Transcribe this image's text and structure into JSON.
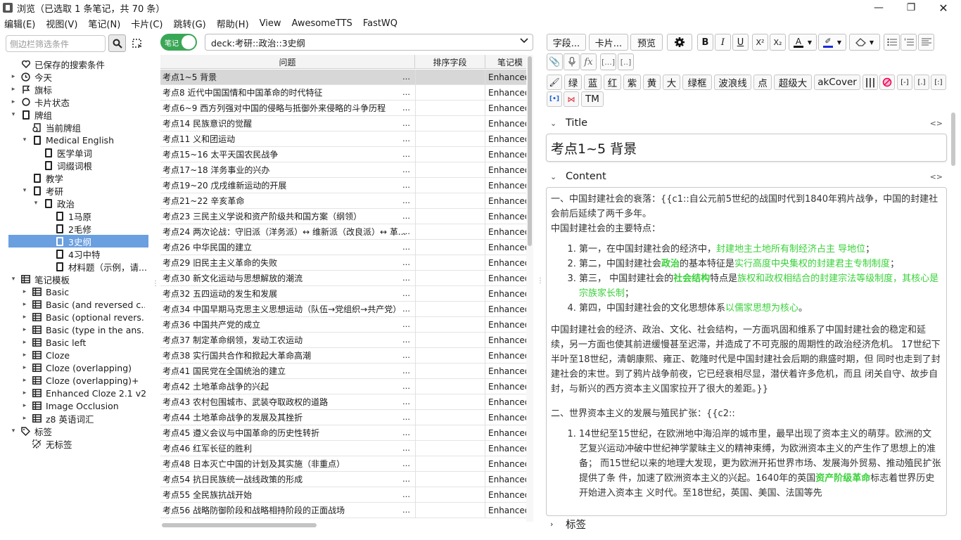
{
  "window": {
    "title": "浏览（已选取 1 条笔记，共 70 条）"
  },
  "menu": [
    "编辑(E)",
    "视图(V)",
    "笔记(N)",
    "卡片(C)",
    "跳转(G)",
    "帮助(H)",
    "View",
    "AwesomeTTS",
    "FastWQ"
  ],
  "sidebar": {
    "search_placeholder": "侧边栏筛选条件",
    "items": [
      {
        "label": "已保存的搜索条件"
      },
      {
        "label": "今天"
      },
      {
        "label": "旗标"
      },
      {
        "label": "卡片状态"
      },
      {
        "label": "牌组"
      },
      {
        "label": "当前牌组"
      },
      {
        "label": "Medical English"
      },
      {
        "label": "医学单词"
      },
      {
        "label": "词缀词根"
      },
      {
        "label": "教学"
      },
      {
        "label": "考研"
      },
      {
        "label": "政治"
      },
      {
        "label": "1马原"
      },
      {
        "label": "2毛修"
      },
      {
        "label": "3史纲"
      },
      {
        "label": "4习中特"
      },
      {
        "label": "材料题（示例，请..."
      },
      {
        "label": "笔记模板"
      },
      {
        "label": "Basic"
      },
      {
        "label": "Basic (and reversed c..."
      },
      {
        "label": "Basic (optional revers..."
      },
      {
        "label": "Basic (type in the ans..."
      },
      {
        "label": "Basic left"
      },
      {
        "label": "Cloze"
      },
      {
        "label": "Cloze (overlapping)"
      },
      {
        "label": "Cloze (overlapping)+"
      },
      {
        "label": "Enhanced Cloze 2.1 v2"
      },
      {
        "label": "Image Occlusion"
      },
      {
        "label": "z8 英语词汇"
      },
      {
        "label": "标签"
      },
      {
        "label": "无标签"
      }
    ]
  },
  "browser": {
    "toggle_label": "笔记",
    "search_value": "deck:考研::政治::3史纲",
    "columns": [
      "问题",
      "排序字段",
      "笔记模"
    ],
    "rows": [
      {
        "q": "考点1~5 背景",
        "type": "Enhanced"
      },
      {
        "q": "考点8 近代中国国情和中国革命的时代特征",
        "type": "Enhanced"
      },
      {
        "q": "考点6~9 西方列强对中国的侵略与抵御外来侵略的斗争历程",
        "type": "Enhanced"
      },
      {
        "q": "考点14 民族意识的觉醒",
        "type": "Enhanced"
      },
      {
        "q": "考点11 义和团运动",
        "type": "Enhanced"
      },
      {
        "q": "考点15~16 太平天国农民战争",
        "type": "Enhanced"
      },
      {
        "q": "考点17~18 洋务事业的兴办",
        "type": "Enhanced"
      },
      {
        "q": "考点19~20 戊戌维新运动的开展",
        "type": "Enhanced"
      },
      {
        "q": "考点21~22 辛亥革命",
        "type": "Enhanced"
      },
      {
        "q": "考点23 三民主义学说和资产阶级共和国方案（纲领）",
        "type": "Enhanced"
      },
      {
        "q": "考点24 两次论战：守旧派（洋务派）↔ 维新派（改良派）↔ 革...",
        "type": "Enhanced"
      },
      {
        "q": "考点26 中华民国的建立",
        "type": "Enhanced"
      },
      {
        "q": "考点29 旧民主主义革命的失败",
        "type": "Enhanced"
      },
      {
        "q": "考点30 新文化运动与思想解放的潮流",
        "type": "Enhanced"
      },
      {
        "q": "考点32 五四运动的发生和发展",
        "type": "Enhanced"
      },
      {
        "q": "考点34 中国早期马克思主义思想运动（队伍→党组织→共产党）",
        "type": "Enhanced"
      },
      {
        "q": "考点36 中国共产党的成立",
        "type": "Enhanced"
      },
      {
        "q": "考点37 制定革命纲领，发动工农运动",
        "type": "Enhanced"
      },
      {
        "q": "考点38 实行国共合作和掀起大革命高潮",
        "type": "Enhanced"
      },
      {
        "q": "考点41 国民党在全国统治的建立",
        "type": "Enhanced"
      },
      {
        "q": "考点42 土地革命战争的兴起",
        "type": "Enhanced"
      },
      {
        "q": "考点43 农村包围城市、武装夺取政权的道路",
        "type": "Enhanced"
      },
      {
        "q": "考点44 土地革命战争的发展及其挫折",
        "type": "Enhanced"
      },
      {
        "q": "考点45 遵义会议与中国革命的历史性转折",
        "type": "Enhanced"
      },
      {
        "q": "考点46 红军长征的胜利",
        "type": "Enhanced"
      },
      {
        "q": "考点48 日本灭亡中国的计划及其实施（非重点）",
        "type": "Enhanced"
      },
      {
        "q": "考点54 抗日民族统一战线政策的形成",
        "type": "Enhanced"
      },
      {
        "q": "考点55 全民族抗战开始",
        "type": "Enhanced"
      },
      {
        "q": "考点56 战略防御阶段和战略相持阶段的正面战场",
        "type": "Enhanced"
      }
    ]
  },
  "editor": {
    "toolbar": {
      "fields_btn": "字段...",
      "cards_btn": "卡片...",
      "preview_btn": "预览"
    },
    "format_buttons": [
      "绿",
      "蓝",
      "红",
      "紫",
      "黄",
      "大",
      "绿框",
      "波浪线",
      "点",
      "超级大",
      "akCover"
    ],
    "format_buttons2": [
      "TM"
    ],
    "title_label": "Title",
    "title_value": "考点1~5 背景",
    "content_label": "Content",
    "tags_label": "标签",
    "content": {
      "p1": "一、中国封建社会的衰落：{{c1::自公元前5世纪的战国时代到1840年鸦片战争，中国的封建社会前后延续了两千多年。",
      "p2": "中国封建社会的主要特点：",
      "li1a": "第一，在中国封建社会的经济中，",
      "li1b": "封建地主土地所有制经济占主 导地位",
      "li1c": "；",
      "li2a": "第二，中国封建社会",
      "li2b": "政治",
      "li2c": "的基本特征是",
      "li2d": "实行高度中央集权的封建君主专制制度",
      "li2e": "；",
      "li3a": "第三，  中国封建社会的",
      "li3b": "社会结构",
      "li3c": "特点是",
      "li3d": "族权和政权相结合的封建宗法等级制度，其核心是宗族家长制",
      "li3e": "；",
      "li4a": "第四，中国封建社会的文化思想体系",
      "li4b": "以儒家思想为核心",
      "li4c": "。",
      "p3": "中国封建社会的经济、政治、文化、社会结构，一方面巩固和维系了中国封建社会的稳定和延续，另一方面也使其前进缓慢甚至迟滞，并造成了不可克服的周期性的政治经济危机。 17世纪下半叶至18世纪，清朝康熙、雍正、乾隆时代是中国封建社会后期的鼎盛时期，但 同时也走到了封建社会的末世。到了鸦片战争前夜，它已经衰相尽显，潜伏着许多危机，而且 闭关自守、故步自封，与新兴的西方资本主义国家拉开了很大的差距。}}",
      "p4": "二、世界资本主义的发展与殖民扩张：{{c2::",
      "li5a": "14世纪至15世纪，在欧洲地中海沿岸的城市里，最早出现了资本主义的萌芽。欧洲的文 艺复兴运动冲破中世纪神学蒙昧主义的精神束缚，为欧洲资本主义的产生作了思想上的准备；  而15世纪以来的地理大发现，更为欧洲开拓世界市场、发展海外贸易、推动殖民扩张提供了条 件，加速了欧洲资本主义的兴起。1640年的英国",
      "li5b": "资产阶级革命",
      "li5c": "标志着世界历史开始进入资本主 义时代。至18世纪，英国、美国、法国等先"
    }
  },
  "colors": {
    "accent_green": "#3aa756",
    "cloze_green": "#3ad13a",
    "selection_blue": "#6a9fe0"
  }
}
